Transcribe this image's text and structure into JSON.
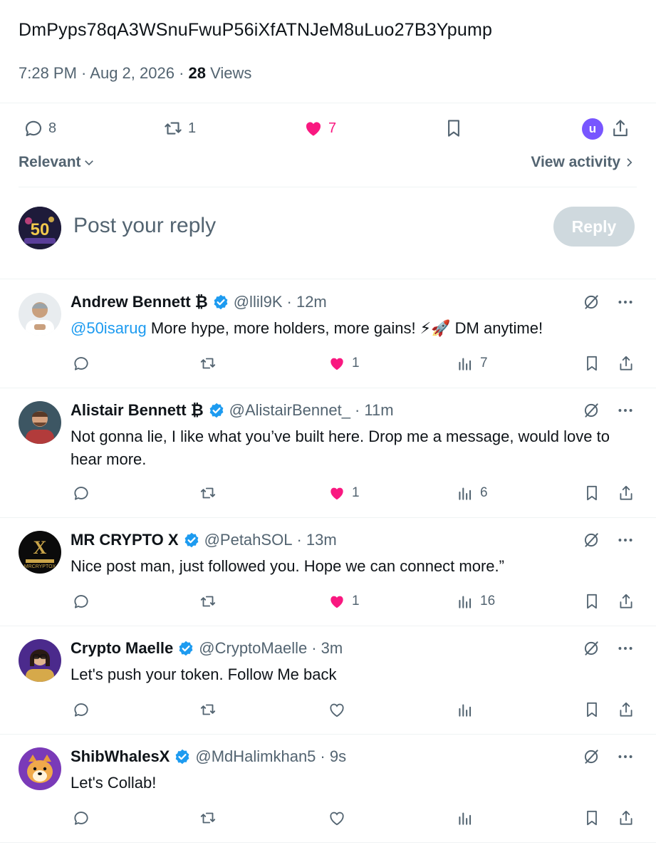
{
  "post": {
    "contract": "DmPyps78qA3WSnuFwuP56iXfATNJeM8uLuo27B3Ypump",
    "time": "7:28 PM",
    "date": "Aug 2, 2026",
    "views_count": "28",
    "views_label": "Views",
    "replies": "8",
    "reposts": "1",
    "likes": "7",
    "user_initial": "u"
  },
  "sort": {
    "label": "Relevant",
    "view_activity": "View activity"
  },
  "composer": {
    "placeholder": "Post your reply",
    "button": "Reply"
  },
  "colors": {
    "like": "#f91880",
    "verified": "#1d9bf0",
    "muted": "#536471"
  },
  "replies": [
    {
      "name": "Andrew Bennett ₿",
      "handle": "@llil9K",
      "time": "· 12m",
      "mention": "@50isarug",
      "text": " More hype, more holders, more gains! ⚡🚀 DM anytime!",
      "likes": "1",
      "views": "7",
      "liked": true
    },
    {
      "name": "Alistair Bennett ₿",
      "handle": "@AlistairBennet_",
      "time": "· 11m",
      "mention": "",
      "text": "Not gonna lie, I like what you’ve built here. Drop me a message, would love to hear more.",
      "likes": "1",
      "views": "6",
      "liked": true
    },
    {
      "name": "MR CRYPTO X",
      "handle": "@PetahSOL",
      "time": "· 13m",
      "mention": "",
      "text": "Nice post man, just followed you. Hope we can connect more.”",
      "likes": "1",
      "views": "16",
      "liked": true
    },
    {
      "name": "Crypto Maelle",
      "handle": "@CryptoMaelle",
      "time": "· 3m",
      "mention": "",
      "text": "Let's push your token. Follow Me back",
      "likes": "",
      "views": "",
      "liked": false
    },
    {
      "name": "ShibWhalesX",
      "handle": "@MdHalimkhan5",
      "time": "· 9s",
      "mention": "",
      "text": "Let's Collab!",
      "likes": "",
      "views": "",
      "liked": false
    }
  ]
}
